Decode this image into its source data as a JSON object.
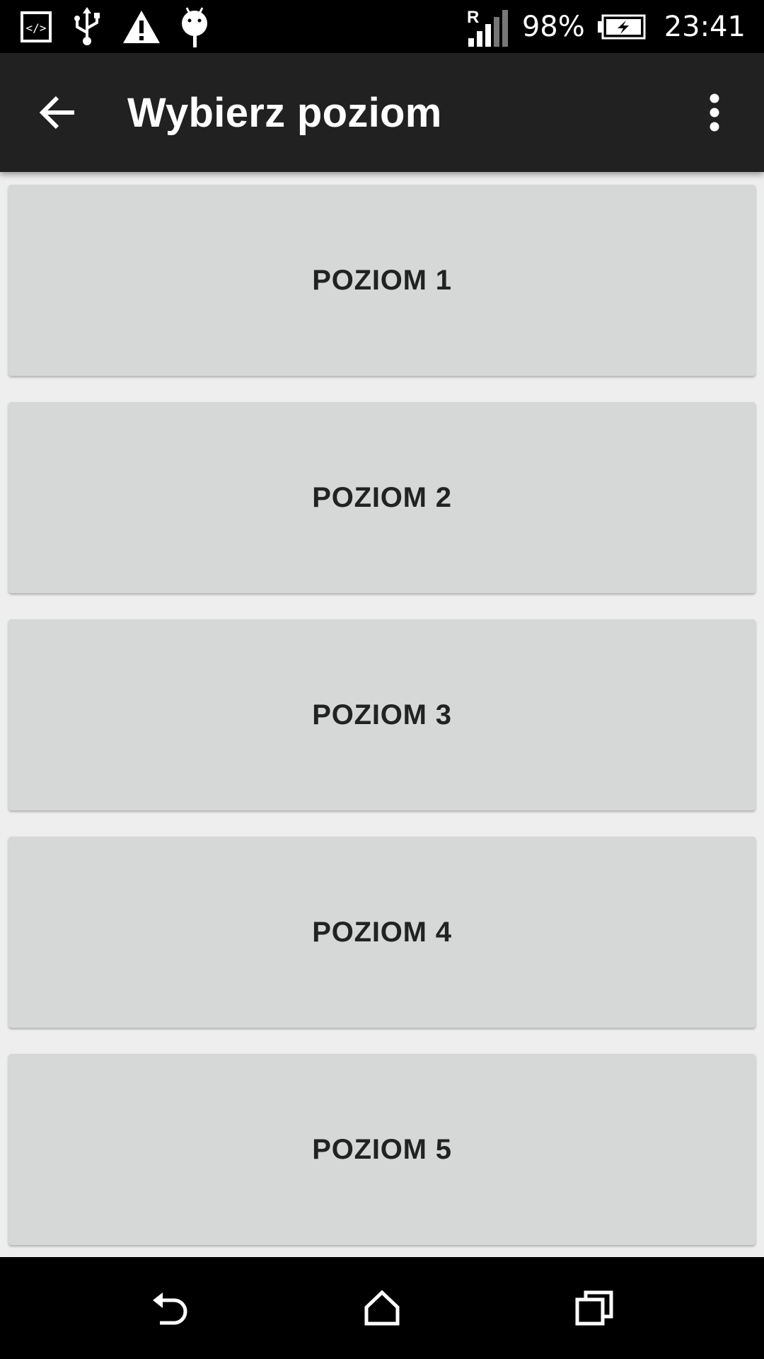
{
  "status_bar": {
    "battery_percent": "98%",
    "time": "23:41",
    "icons": [
      "developer-mode-icon",
      "usb-icon",
      "warning-icon",
      "android-debug-icon",
      "signal-roaming-icon",
      "battery-charging-icon"
    ]
  },
  "app_bar": {
    "title": "Wybierz poziom",
    "back_icon": "arrow-back-icon",
    "overflow_icon": "more-vert-icon"
  },
  "levels": [
    {
      "label": "POZIOM 1"
    },
    {
      "label": "POZIOM 2"
    },
    {
      "label": "POZIOM 3"
    },
    {
      "label": "POZIOM 4"
    },
    {
      "label": "POZIOM 5"
    }
  ],
  "nav_bar": {
    "icons": [
      "nav-back-icon",
      "nav-home-icon",
      "nav-recents-icon"
    ]
  },
  "colors": {
    "status_bar_bg": "#000000",
    "app_bar_bg": "#212121",
    "content_bg": "#eeeeee",
    "button_bg": "#d6d7d7",
    "button_text": "#222222",
    "nav_bar_bg": "#000000"
  }
}
